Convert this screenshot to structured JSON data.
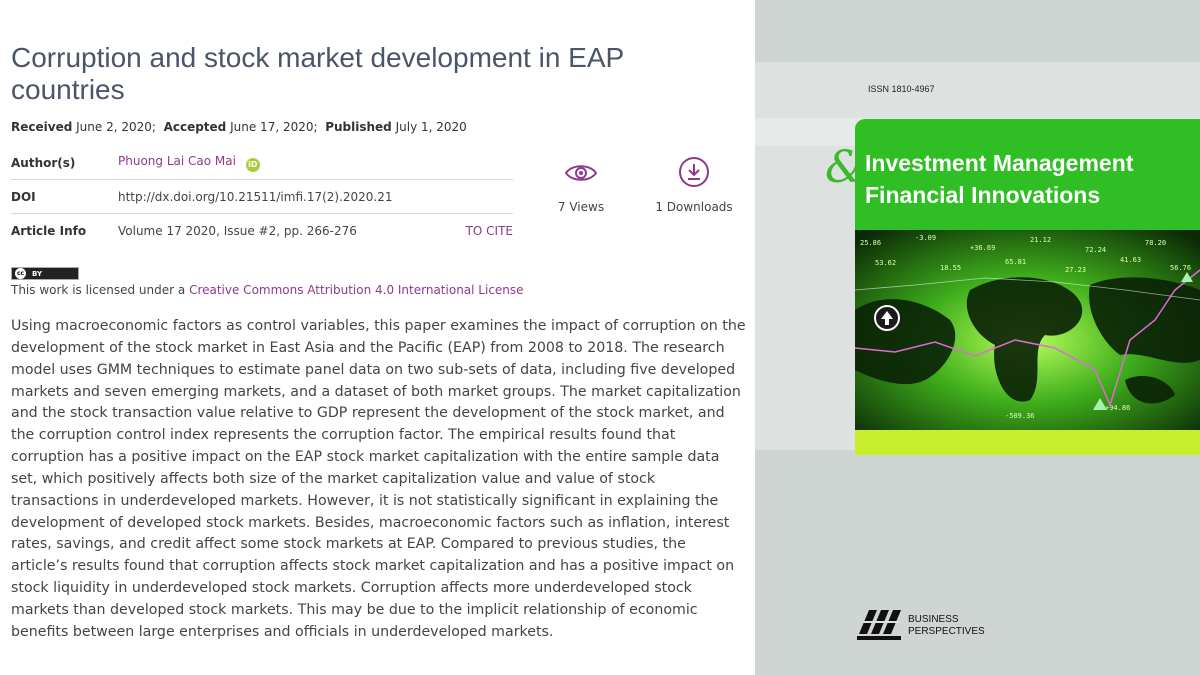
{
  "article": {
    "title": "Corruption and stock market development in EAP countries",
    "received_label": "Received",
    "received_date": "June 2, 2020;",
    "accepted_label": "Accepted",
    "accepted_date": "June 17, 2020;",
    "published_label": "Published",
    "published_date": "July 1, 2020",
    "author_label": "Author(s)",
    "author_name": "Phuong Lai Cao Mai",
    "doi_label": "DOI",
    "doi_value": "http://dx.doi.org/10.21511/imfi.17(2).2020.21",
    "info_label": "Article Info",
    "info_value": "Volume 17 2020, Issue #2, pp. 266-276",
    "to_cite": "TO CITE"
  },
  "stats": {
    "views": "7 Views",
    "downloads": "1 Downloads"
  },
  "license": {
    "badge_text": "BY",
    "prefix": "This work is licensed under a",
    "link": "Creative Commons Attribution 4.0 International License"
  },
  "abstract": "Using macroeconomic factors as control variables, this paper examines the impact of corruption on the development of the stock market in East Asia and the Pacific (EAP) from 2008 to 2018. The research model uses GMM techniques to estimate panel data on two sub-sets of data, including five developed markets and seven emerging markets, and a dataset of both market groups. The market capitalization and the stock transaction value relative to GDP represent the development of the stock market, and the corruption control index represents the corruption factor. The empirical results found that corruption has a positive impact on the EAP stock market capitalization with the entire sample data set, which positively affects both size of the market capitalization value and value of stock transactions in underdeveloped markets. However, it is not statistically significant in explaining the development of developed stock markets. Besides, macroeconomic factors such as inflation, interest rates, savings, and credit affect some stock markets at EAP. Compared to previous studies, the article’s results found that corruption affects stock market capitalization and has a positive impact on stock liquidity in underdeveloped stock markets. Corruption affects more underdeveloped stock markets than developed stock markets. This may be due to the implicit relationship of economic benefits between large enterprises and officials in underdeveloped markets.",
  "cover": {
    "issn": "ISSN 1810-4967",
    "journal_line1": "Investment Management",
    "journal_line2": "Financial Innovations",
    "amp": "&",
    "publisher_line1": "BUSINESS",
    "publisher_line2": "PERSPECTIVES",
    "publisher_logo": "BP",
    "green": "#2fbf24",
    "lime": "#c8ee2e"
  },
  "icons": {
    "views": "eye-icon",
    "downloads": "download-icon",
    "orcid": "orcid-icon"
  }
}
